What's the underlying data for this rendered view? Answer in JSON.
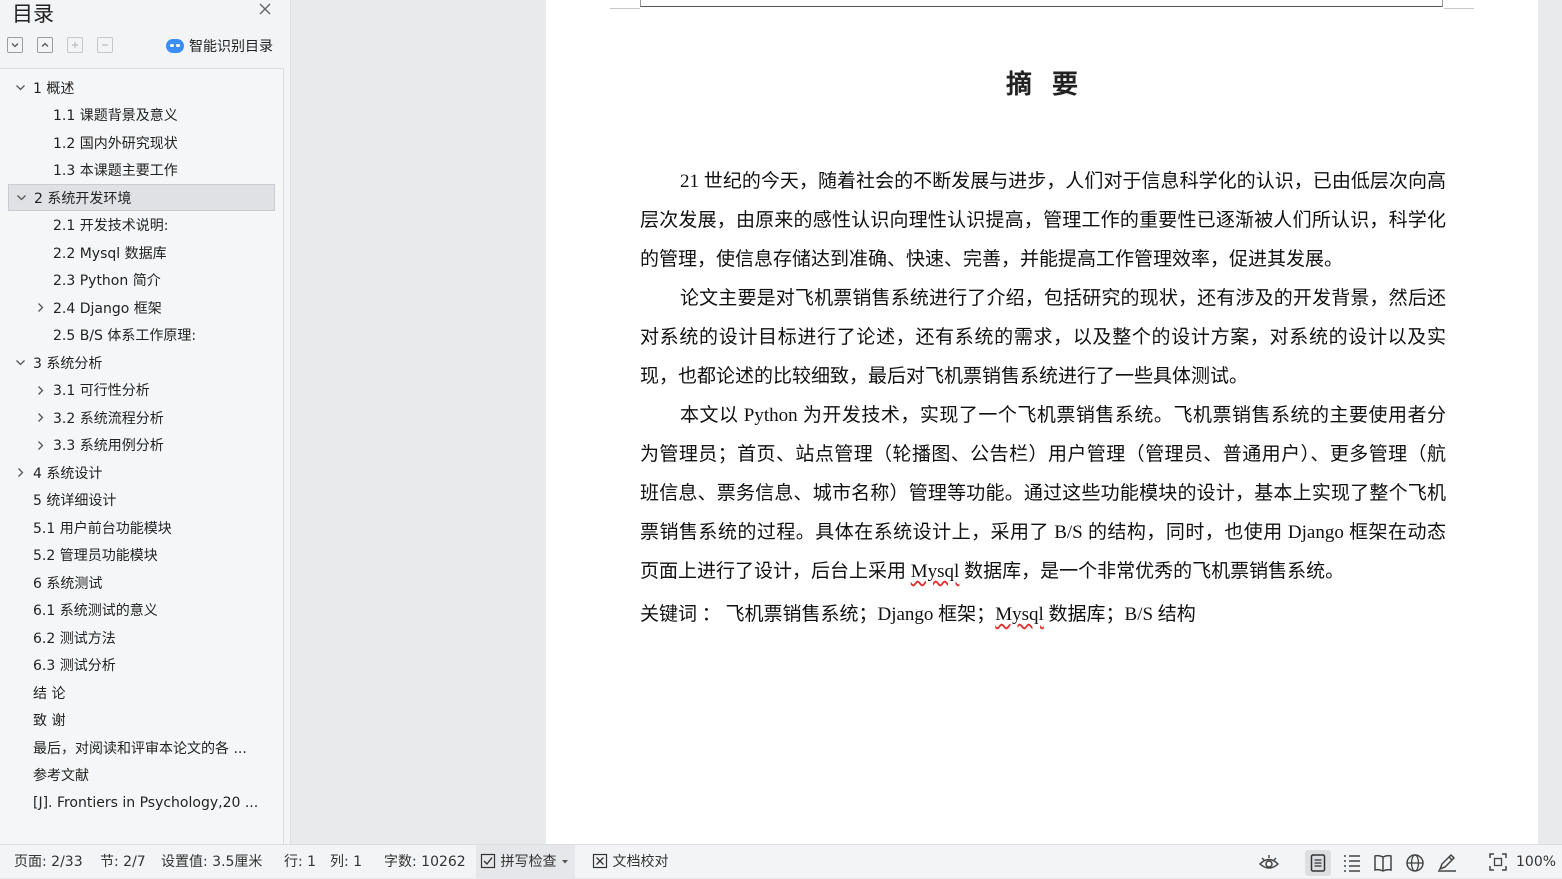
{
  "toc": {
    "title": "目录",
    "close_icon": "close-icon",
    "toolbar": {
      "expand_icon": "expand-all-icon",
      "collapse_icon": "collapse-all-icon",
      "add_icon": "add-level-icon",
      "remove_icon": "remove-level-icon"
    },
    "smart_toc_label": "智能识别目录",
    "items": [
      {
        "label": "1  概述",
        "chevron": "down",
        "level": 1,
        "selected": false
      },
      {
        "label": "1.1 课题背景及意义",
        "chevron": "none",
        "level": 2,
        "selected": false
      },
      {
        "label": "1.2  国内外研究现状",
        "chevron": "none",
        "level": 2,
        "selected": false
      },
      {
        "label": "1.3  本课题主要工作",
        "chevron": "none",
        "level": 2,
        "selected": false
      },
      {
        "label": "2  系统开发环境",
        "chevron": "down",
        "level": 1,
        "selected": true
      },
      {
        "label": "2.1  开发技术说明:",
        "chevron": "none",
        "level": 2,
        "selected": false
      },
      {
        "label": "2.2 Mysql 数据库",
        "chevron": "none",
        "level": 2,
        "selected": false
      },
      {
        "label": "2.3 Python 简介",
        "chevron": "none",
        "level": 2,
        "selected": false
      },
      {
        "label": "2.4 Django 框架",
        "chevron": "right",
        "level": 2,
        "selected": false
      },
      {
        "label": "2.5 B/S 体系工作原理:",
        "chevron": "none",
        "level": 2,
        "selected": false
      },
      {
        "label": "3  系统分析",
        "chevron": "down",
        "level": 1,
        "selected": false
      },
      {
        "label": "3.1  可行性分析",
        "chevron": "right",
        "level": 2,
        "selected": false
      },
      {
        "label": "3.2 系统流程分析",
        "chevron": "right",
        "level": 2,
        "selected": false
      },
      {
        "label": "3.3 系统用例分析",
        "chevron": "right",
        "level": 2,
        "selected": false
      },
      {
        "label": "4  系统设计",
        "chevron": "right",
        "level": 1,
        "selected": false
      },
      {
        "label": "5 统详细设计",
        "chevron": "none",
        "level": 1,
        "selected": false
      },
      {
        "label": "5.1 用户前台功能模块",
        "chevron": "none",
        "level": 1,
        "selected": false
      },
      {
        "label": "5.2 管理员功能模块",
        "chevron": "none",
        "level": 1,
        "selected": false
      },
      {
        "label": "6 系统测试",
        "chevron": "none",
        "level": 1,
        "selected": false
      },
      {
        "label": "6.1 系统测试的意义",
        "chevron": "none",
        "level": 1,
        "selected": false
      },
      {
        "label": "6.2  测试方法",
        "chevron": "none",
        "level": 1,
        "selected": false
      },
      {
        "label": "6.3 测试分析",
        "chevron": "none",
        "level": 1,
        "selected": false
      },
      {
        "label": "结      论",
        "chevron": "none",
        "level": 1,
        "selected": false
      },
      {
        "label": "致      谢",
        "chevron": "none",
        "level": 1,
        "selected": false
      },
      {
        "label": "最后，对阅读和评审本论文的各 ...",
        "chevron": "none",
        "level": 1,
        "selected": false
      },
      {
        "label": "参考文献",
        "chevron": "none",
        "level": 1,
        "selected": false
      },
      {
        "label": "[J]. Frontiers in Psychology,20 ...",
        "chevron": "none",
        "level": 1,
        "selected": false
      }
    ]
  },
  "document": {
    "heading": "摘要",
    "paragraphs": [
      "21 世纪的今天，随着社会的不断发展与进步，人们对于信息科学化的认识，已由低层次向高层次发展，由原来的感性认识向理性认识提高，管理工作的重要性已逐渐被人们所认识，科学化的管理，使信息存储达到准确、快速、完善，并能提高工作管理效率，促进其发展。",
      "论文主要是对飞机票销售系统进行了介绍，包括研究的现状，还有涉及的开发背景，然后还对系统的设计目标进行了论述，还有系统的需求，以及整个的设计方案，对系统的设计以及实现，也都论述的比较细致，最后对飞机票销售系统进行了一些具体测试。",
      {
        "before": "本文以 Python 为开发技术，实现了一个飞机票销售系统。飞机票销售系统的主要使用者分为管理员；首页、站点管理（轮播图、公告栏）用户管理（管理员、普通用户）、更多管理（航班信息、票务信息、城市名称）管理等功能。通过这些功能模块的设计，基本上实现了整个飞机票销售系统的过程。具体在系统设计上，采用了 B/S 的结构，同时，也使用 Django 框架在动态页面上进行了设计，后台上采用 ",
        "flagged": "Mysql",
        "after": " 数据库，是一个非常优秀的飞机票销售系统。"
      }
    ],
    "keywords": {
      "before": "关键词 ： 飞机票销售系统；Django 框架；",
      "flagged": "Mysql",
      "after": " 数据库；B/S 结构"
    }
  },
  "status_bar": {
    "page": "页面: 2/33",
    "section": "节: 2/7",
    "setting": "设置值: 3.5厘米",
    "row": "行: 1",
    "col": "列: 1",
    "word_count": "字数: 10262",
    "spellcheck_label": "拼写检查",
    "proofread_label": "文档校对",
    "zoom": "100%",
    "icons": [
      "eye-protection-icon",
      "page-view-icon",
      "outline-view-icon",
      "reading-view-icon",
      "web-view-icon",
      "write-mode-icon",
      "fit-page-icon"
    ]
  },
  "colors": {
    "panel_bg": "#f3f4f5",
    "selected_row": "#dfe1e5",
    "smart_toc_accent": "#3a8ef6",
    "spell_underline": "#e03030"
  }
}
